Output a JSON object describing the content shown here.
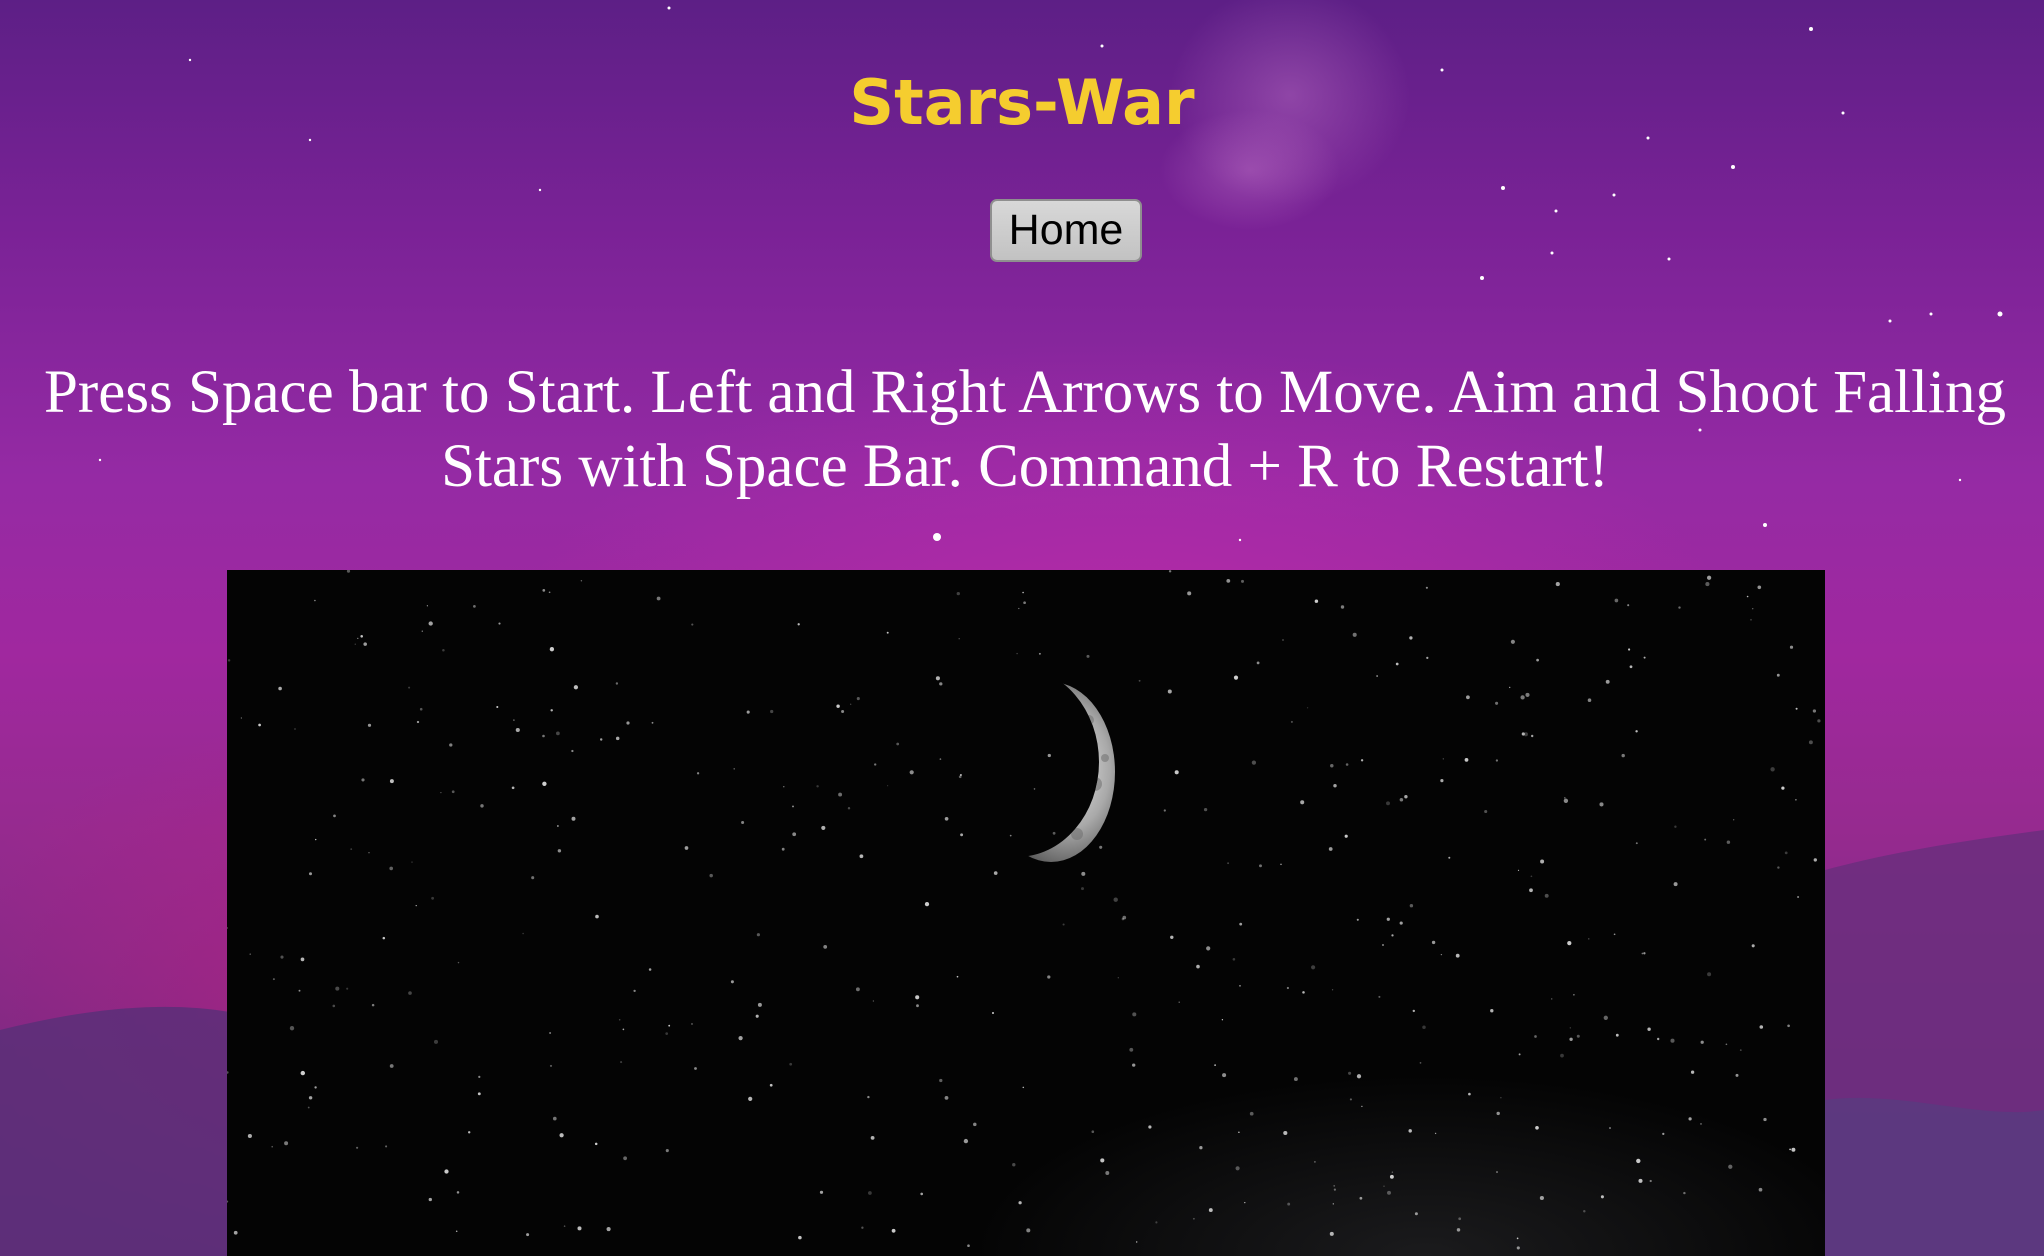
{
  "page": {
    "title": "Stars-War",
    "nav": {
      "home_label": "Home"
    },
    "instructions": "Press Space bar to Start. Left and Right Arrows to Move. Aim and Shoot Falling Stars with Space Bar. Command + R to Restart!"
  },
  "colors": {
    "title": "#f5cd2f",
    "background": "#952aa4",
    "canvas": "#040404"
  },
  "game": {
    "scene_icons": [
      "moon-icon",
      "starfield"
    ]
  }
}
